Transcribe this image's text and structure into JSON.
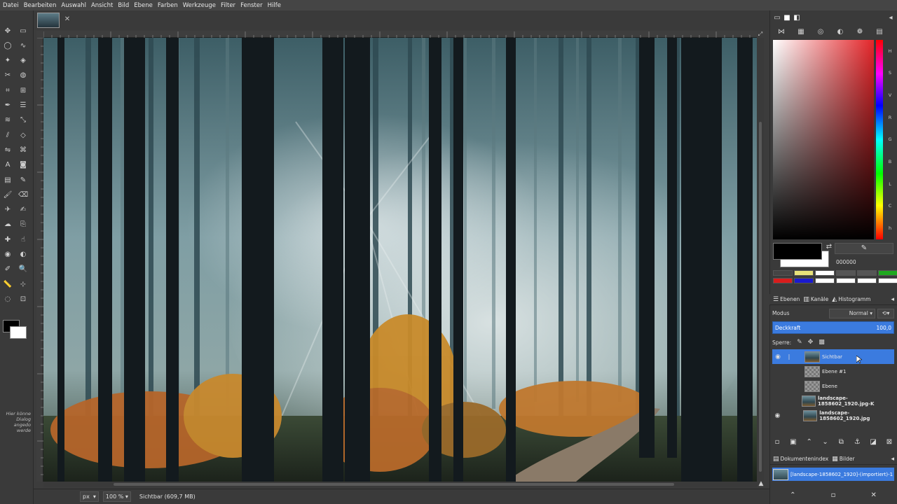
{
  "menu": [
    "Datei",
    "Bearbeiten",
    "Auswahl",
    "Ansicht",
    "Bild",
    "Ebene",
    "Farben",
    "Werkzeuge",
    "Filter",
    "Fenster",
    "Hilfe"
  ],
  "toolbox": {
    "dock_hint": "Hier könne Dialog angedo werde",
    "tools": [
      "move-tool-icon",
      "rect-select-icon",
      "ellipse-select-icon",
      "lasso-icon",
      "fuzzy-select-icon",
      "select-by-color-icon",
      "scissors-icon",
      "foreground-select-icon",
      "crop-icon",
      "unified-transform-icon",
      "paths-icon",
      "align-icon",
      "warp-icon",
      "scale-icon",
      "shear-icon",
      "perspective-icon",
      "flip-icon",
      "cage-icon",
      "text-icon",
      "bucket-fill-icon",
      "gradient-icon",
      "pencil-icon",
      "paintbrush-icon",
      "eraser-icon",
      "airbrush-icon",
      "ink-icon",
      "mypaint-icon",
      "clone-icon",
      "heal-icon",
      "smudge-icon",
      "blur-icon",
      "dodge-icon",
      "color-picker-icon",
      "zoom-icon",
      "measure-icon",
      "handle-transform-icon",
      "paint-select-icon",
      "transform-icon"
    ]
  },
  "status": {
    "unit": "px",
    "zoom": "100 %",
    "text": "Sichtbar (609,7 MB)"
  },
  "colors": {
    "fg_hex": "000000",
    "accent": "#3b7bdf",
    "swatches": [
      "#444444",
      "#e8e27a",
      "#ffffff",
      "#555555",
      "#555555",
      "#1fa81f",
      "#d81c1c",
      "#1a1ad0",
      "#ffffff",
      "#ffffff",
      "#ffffff",
      "#ffffff"
    ]
  },
  "panels": {
    "tabs": [
      "Ebenen",
      "Kanäle",
      "Histogramm"
    ],
    "mode_label": "Modus",
    "mode_value": "Normal",
    "opacity_label": "Deckkraft",
    "opacity_value": "100,0",
    "lock_label": "Sperre:",
    "layers": [
      {
        "name": "Sichtbar",
        "visible": true,
        "selected": true,
        "thumb": "img",
        "bold": false
      },
      {
        "name": "Ebene #1",
        "visible": false,
        "selected": false,
        "thumb": "checker",
        "bold": false
      },
      {
        "name": "Ebene",
        "visible": false,
        "selected": false,
        "thumb": "checker",
        "bold": false
      },
      {
        "name": "landscape-1858602_1920.jpg-K",
        "visible": false,
        "selected": false,
        "thumb": "img",
        "bold": true
      },
      {
        "name": "landscape-1858602_1920.jpg",
        "visible": true,
        "selected": false,
        "thumb": "img",
        "bold": true
      }
    ],
    "doc_tabs": [
      "Dokumentenindex",
      "Bilder"
    ],
    "image_entry": "[landscape-1858602_1920]-(importiert)-1"
  }
}
